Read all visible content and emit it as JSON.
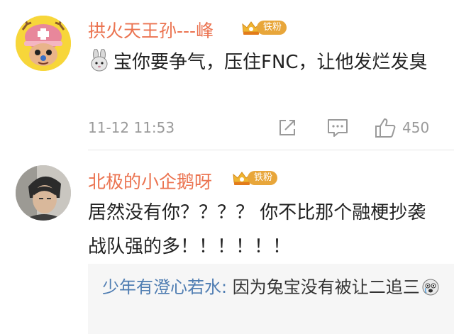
{
  "comments": [
    {
      "username": "拱火天王孙---峰",
      "badge": "铁粉",
      "text": "宝你要争气，压住FNC，让他发烂发臭",
      "text_emoji": "bunny-emoji",
      "time": "11-12 11:53",
      "likes": "450",
      "avatar": "chopper-avatar"
    },
    {
      "username": "北极的小企鹅呀",
      "badge": "铁粉",
      "text": "居然没有你？？？？ 你不比那个融梗抄袭战队强的多！！！！！！",
      "avatar": "photo-avatar",
      "sub_reply": {
        "author": "少年有澄心若水:",
        "text": " 因为兔宝没有被让二追三",
        "emoji": "crying-face-emoji"
      }
    }
  ],
  "colors": {
    "username": "#eb7350",
    "badge": "#e8a63a",
    "sub_author": "#4f7db2",
    "meta": "#9a9a9a"
  },
  "icons": [
    "share-icon",
    "comment-icon",
    "thumbs-up-icon",
    "crown-icon"
  ]
}
